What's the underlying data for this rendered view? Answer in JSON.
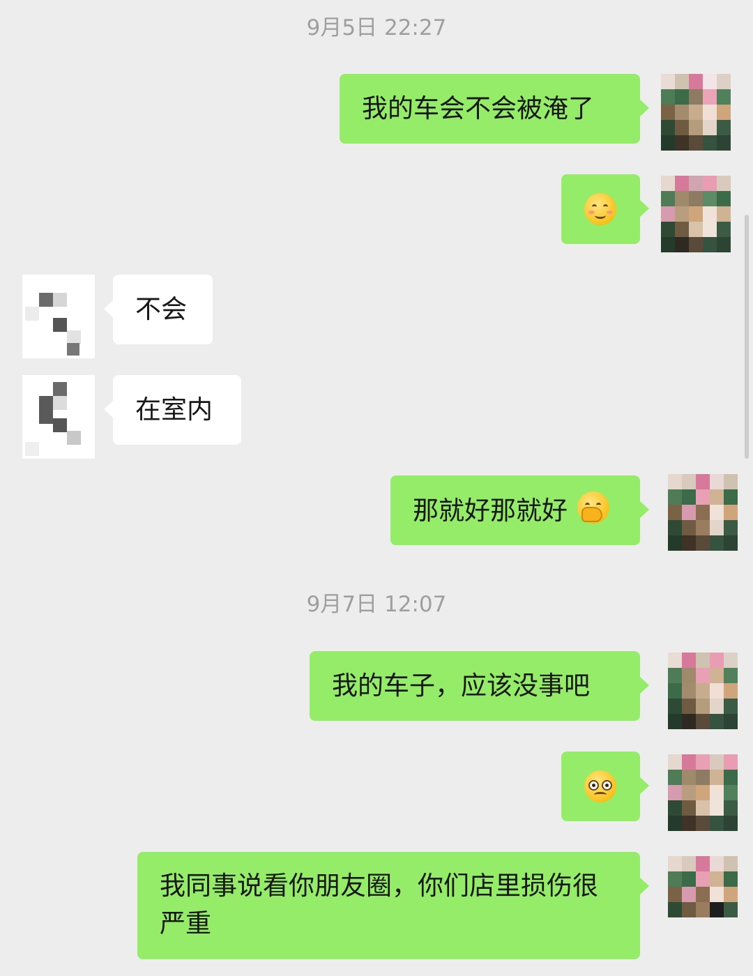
{
  "timestamps": [
    "9月5日 22:27",
    "9月7日 12:07"
  ],
  "messages": [
    {
      "sender": "me",
      "text": "我的车会不会被淹了"
    },
    {
      "sender": "me",
      "emoji": "smiling-face-icon"
    },
    {
      "sender": "them",
      "text": "不会"
    },
    {
      "sender": "them",
      "text": "在室内"
    },
    {
      "sender": "me",
      "text": "那就好那就好",
      "emoji": "hand-over-mouth-icon"
    },
    {
      "sender": "me",
      "text": "我的车子，应该没事吧"
    },
    {
      "sender": "me",
      "emoji": "pleading-face-icon"
    },
    {
      "sender": "me",
      "text": "我同事说看你朋友圈，你们店里损伤很严重"
    }
  ],
  "colors": {
    "background": "#ededed",
    "my_bubble": "#95ec69",
    "their_bubble": "#ffffff",
    "timestamp_text": "#9f9f9f"
  }
}
